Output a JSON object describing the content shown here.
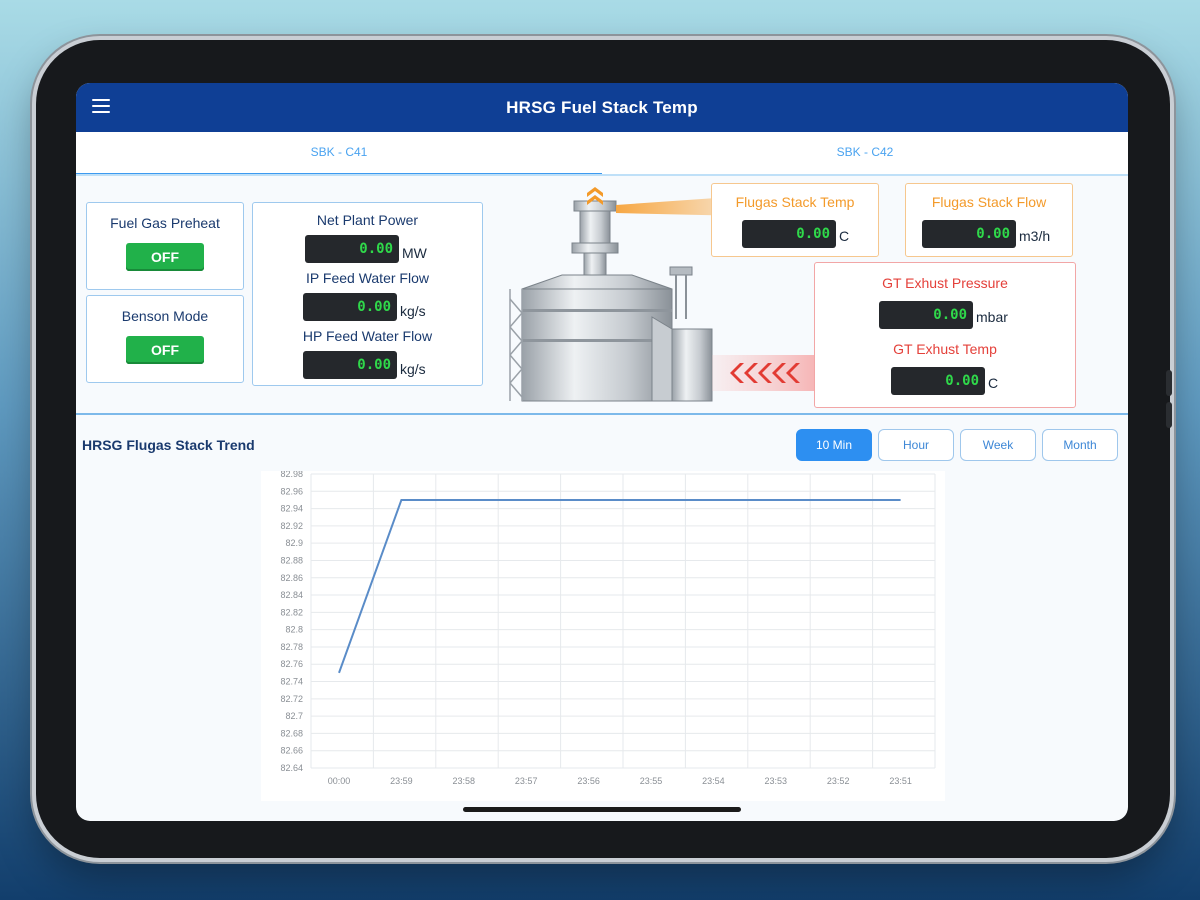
{
  "app": {
    "title": "HRSG Fuel Stack Temp"
  },
  "tabs": [
    {
      "label": "SBK - C41",
      "active": true
    },
    {
      "label": "SBK - C42",
      "active": false
    }
  ],
  "fuel_gas_preheat": {
    "label": "Fuel Gas Preheat",
    "state": "OFF"
  },
  "benson_mode": {
    "label": "Benson Mode",
    "state": "OFF"
  },
  "metrics": {
    "net_plant_power": {
      "label": "Net Plant Power",
      "value": "0.00",
      "unit": "MW"
    },
    "ip_feed_water_flow": {
      "label": "IP Feed Water Flow",
      "value": "0.00",
      "unit": "kg/s"
    },
    "hp_feed_water_flow": {
      "label": "HP Feed Water Flow",
      "value": "0.00",
      "unit": "kg/s"
    }
  },
  "stack": {
    "flugas_stack_temp": {
      "label": "Flugas Stack Temp",
      "value": "0.00",
      "unit": "C"
    },
    "flugas_stack_flow": {
      "label": "Flugas Stack Flow",
      "value": "0.00",
      "unit": "m3/h"
    },
    "gt_exhust_pressure": {
      "label": "GT Exhust Pressure",
      "value": "0.00",
      "unit": "mbar"
    },
    "gt_exhust_temp": {
      "label": "GT Exhust Temp",
      "value": "0.00",
      "unit": "C"
    }
  },
  "trend": {
    "title": "HRSG Flugas Stack Trend",
    "ranges": [
      {
        "label": "10 Min",
        "active": true
      },
      {
        "label": "Hour",
        "active": false
      },
      {
        "label": "Week",
        "active": false
      },
      {
        "label": "Month",
        "active": false
      }
    ]
  },
  "colors": {
    "appbar": "#0f3f95",
    "accent": "#2d8ff1",
    "off_button": "#21b14a",
    "value_text": "#2fd84a",
    "orange_label": "#f39a2a",
    "red_label": "#e4403a"
  },
  "chart_data": {
    "type": "line",
    "title": "",
    "xlabel": "",
    "ylabel": "",
    "categories": [
      "00:00",
      "23:59",
      "23:58",
      "23:57",
      "23:56",
      "23:55",
      "23:54",
      "23:53",
      "23:52",
      "23:51"
    ],
    "series": [
      {
        "values": [
          82.75,
          82.95,
          82.95,
          82.95,
          82.95,
          82.95,
          82.95,
          82.95,
          82.95,
          82.95
        ]
      }
    ],
    "y_ticks": [
      "82.98",
      "82.96",
      "82.94",
      "82.92",
      "82.9",
      "82.88",
      "82.86",
      "82.84",
      "82.82",
      "82.8",
      "82.78",
      "82.76",
      "82.74",
      "82.72",
      "82.7",
      "82.68",
      "82.66",
      "82.64"
    ],
    "ylim": [
      82.64,
      82.98
    ],
    "grid": true,
    "line_color": "#5a8cc8"
  }
}
